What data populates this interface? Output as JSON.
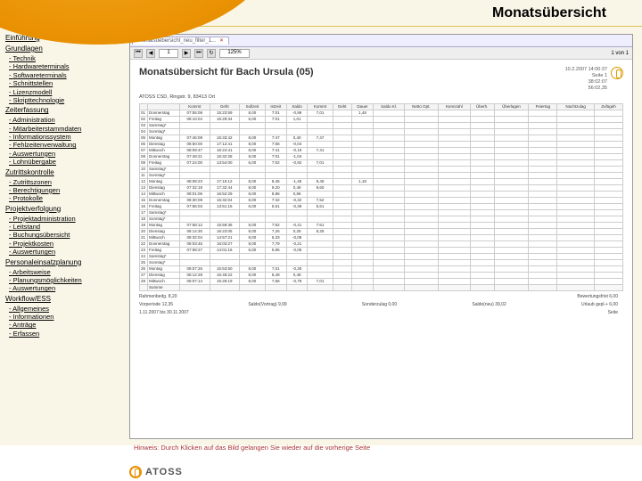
{
  "header": {
    "title": "Monatsübersicht"
  },
  "sidebar": [
    {
      "label": "Einführung",
      "items": []
    },
    {
      "label": "Grundlagen",
      "items": [
        "Technik",
        "Hardwareterminals",
        "Softwareterminals",
        "Schnittstellen",
        "Lizenzmodell",
        "Skripttechnologie"
      ]
    },
    {
      "label": "Zeiterfassung",
      "items": [
        "Administration",
        "Mitarbeiterstammdaten",
        "Informationssystem",
        "Fehlzeitenverwaltung",
        "Auswertungen",
        "Lohnübergabe"
      ]
    },
    {
      "label": "Zutrittskontrolle",
      "items": [
        "Zutrittszonen",
        "Berechtigungen",
        "Protokolle"
      ]
    },
    {
      "label": "Projektverfolgung",
      "items": [
        "Projektadministration",
        "Leitstand",
        "Buchungsübersicht",
        "Projektkosten",
        "Auswertungen"
      ]
    },
    {
      "label": "Personaleinsatzplanung",
      "items": [
        "Arbeitsweise",
        "Planungsmöglichkeiten",
        "Auswertungen"
      ]
    },
    {
      "label": "Workflow/ESS",
      "items": [
        "Allgemeines",
        "Informationen",
        "Anträge",
        "Erfassen"
      ]
    }
  ],
  "tab": {
    "label": "Monatsuebersicht_neu_filter_1...",
    "close": "×"
  },
  "toolbar": {
    "page_value": "1",
    "page_of": "1 von 1",
    "zoom": "125%"
  },
  "doc": {
    "title": "Monatsübersicht für Bach Ursula (05)",
    "meta_right": [
      "10.2.2007 14:00:37",
      "Seite 1",
      "38:02:07",
      "56:02,35"
    ],
    "subline": "ATOSS CSD, Ringstr. 9, 83413 Ort",
    "columns": [
      "",
      "",
      "Kommt",
      "Geht",
      "Sollzeit",
      "Istzeit",
      "Saldo",
      "Kommt",
      "Geht",
      "Dauer",
      "Saldo Kl.",
      "Netto Opt.",
      "Kennzahl",
      "Überh.",
      "Überlagen",
      "Feiertag",
      "Nachtzulag",
      "Zufügeh"
    ],
    "rows": [
      [
        "01",
        "Donnerstag",
        "07:55:08",
        "15:23:59",
        "8,00",
        "7:01",
        "-0,99",
        "7,01",
        "",
        "1,48",
        "",
        "",
        "",
        "",
        "",
        "",
        "",
        ""
      ],
      [
        "02",
        "Freitag",
        "08:10:04",
        "15:29:34",
        "6,00",
        "7:01",
        "1,01",
        "",
        "",
        "",
        "",
        "",
        "",
        "",
        "",
        "",
        "",
        ""
      ],
      [
        "03",
        "Samstag*",
        "",
        "",
        "",
        "",
        "",
        "",
        "",
        "",
        "",
        "",
        "",
        "",
        "",
        "",
        "",
        ""
      ],
      [
        "04",
        "Sonntag*",
        "",
        "",
        "",
        "",
        "",
        "",
        "",
        "",
        "",
        "",
        "",
        "",
        "",
        "",
        "",
        ""
      ],
      [
        "05",
        "Montag",
        "07:46:08",
        "15:33:42",
        "8,00",
        "7:47",
        "0,40",
        "7,47",
        "",
        "",
        "",
        "",
        "",
        "",
        "",
        "",
        "",
        ""
      ],
      [
        "06",
        "Dienstag",
        "08:50:00",
        "17:12:41",
        "8,00",
        "7:56",
        "-0,04",
        "",
        "",
        "",
        "",
        "",
        "",
        "",
        "",
        "",
        "",
        ""
      ],
      [
        "07",
        "Mittwoch",
        "08:09:47",
        "16:24:41",
        "8,00",
        "7:41",
        "-0,19",
        "7,41",
        "",
        "",
        "",
        "",
        "",
        "",
        "",
        "",
        "",
        ""
      ],
      [
        "08",
        "Donnerstag",
        "07:48:21",
        "16:32:28",
        "8,00",
        "7:01",
        "-1,04",
        "",
        "",
        "",
        "",
        "",
        "",
        "",
        "",
        "",
        "",
        ""
      ],
      [
        "09",
        "Freitag",
        "07:24:00",
        "13:54:00",
        "6,00",
        "7:02",
        "-0,92",
        "7,01",
        "",
        "",
        "",
        "",
        "",
        "",
        "",
        "",
        "",
        ""
      ],
      [
        "10",
        "Samstag*",
        "",
        "",
        "",
        "",
        "",
        "",
        "",
        "",
        "",
        "",
        "",
        "",
        "",
        "",
        "",
        ""
      ],
      [
        "11",
        "Sonntag*",
        "",
        "",
        "",
        "",
        "",
        "",
        "",
        "",
        "",
        "",
        "",
        "",
        "",
        "",
        "",
        ""
      ],
      [
        "12",
        "Montag",
        "08:08:23",
        "17:15:12",
        "8,00",
        "8,45",
        "-1,45",
        "8,45",
        "",
        "1,18",
        "",
        "",
        "",
        "",
        "",
        "",
        "",
        ""
      ],
      [
        "13",
        "Dienstag",
        "07:32:19",
        "17:32:44",
        "8,00",
        "9,20",
        "0,46",
        "9,60",
        "",
        "",
        "",
        "",
        "",
        "",
        "",
        "",
        "",
        ""
      ],
      [
        "14",
        "Mittwoch",
        "08:01:06",
        "16:52:29",
        "8,00",
        "8,86",
        "0,86",
        "",
        "",
        "",
        "",
        "",
        "",
        "",
        "",
        "",
        "",
        ""
      ],
      [
        "15",
        "Donnerstag",
        "08:30:08",
        "16:32:04",
        "8,00",
        "7:32",
        "-0,32",
        "7,52",
        "",
        "",
        "",
        "",
        "",
        "",
        "",
        "",
        "",
        ""
      ],
      [
        "16",
        "Freitag",
        "07:55:03",
        "13:51:15",
        "6,00",
        "5,61",
        "-0,39",
        "5,61",
        "",
        "",
        "",
        "",
        "",
        "",
        "",
        "",
        "",
        ""
      ],
      [
        "17",
        "Samstag*",
        "",
        "",
        "",
        "",
        "",
        "",
        "",
        "",
        "",
        "",
        "",
        "",
        "",
        "",
        "",
        ""
      ],
      [
        "18",
        "Sonntag*",
        "",
        "",
        "",
        "",
        "",
        "",
        "",
        "",
        "",
        "",
        "",
        "",
        "",
        "",
        "",
        ""
      ],
      [
        "19",
        "Montag",
        "07:58:12",
        "15:59:36",
        "8,00",
        "7:62",
        "-0,41",
        "7:61",
        "",
        "",
        "",
        "",
        "",
        "",
        "",
        "",
        "",
        ""
      ],
      [
        "20",
        "Dienstag",
        "08:14:30",
        "16:23:05",
        "8,00",
        "7,25",
        "0,25",
        "8,25",
        "",
        "",
        "",
        "",
        "",
        "",
        "",
        "",
        "",
        ""
      ],
      [
        "21",
        "Mittwoch",
        "08:32:04",
        "14:57:21",
        "8,00",
        "6,33",
        "-0,08",
        "",
        "",
        "",
        "",
        "",
        "",
        "",
        "",
        "",
        "",
        ""
      ],
      [
        "22",
        "Donnerstag",
        "08:03:45",
        "16:03:27",
        "8,00",
        "7,79",
        "-0,21",
        "",
        "",
        "",
        "",
        "",
        "",
        "",
        "",
        "",
        "",
        ""
      ],
      [
        "23",
        "Freitag",
        "07:58:27",
        "14:01:16",
        "6,00",
        "5,95",
        "-0,05",
        "",
        "",
        "",
        "",
        "",
        "",
        "",
        "",
        "",
        "",
        ""
      ],
      [
        "24",
        "Samstag*",
        "",
        "",
        "",
        "",
        "",
        "",
        "",
        "",
        "",
        "",
        "",
        "",
        "",
        "",
        "",
        ""
      ],
      [
        "25",
        "Sonntag*",
        "",
        "",
        "",
        "",
        "",
        "",
        "",
        "",
        "",
        "",
        "",
        "",
        "",
        "",
        "",
        ""
      ],
      [
        "26",
        "Montag",
        "08:07:26",
        "15:53:50",
        "8,00",
        "7,01",
        "-0,30",
        "",
        "",
        "",
        "",
        "",
        "",
        "",
        "",
        "",
        "",
        ""
      ],
      [
        "27",
        "Dienstag",
        "08:12:28",
        "16:48:22",
        "8,00",
        "8,48",
        "0,48",
        "",
        "",
        "",
        "",
        "",
        "",
        "",
        "",
        "",
        "",
        ""
      ],
      [
        "28",
        "Mittwoch",
        "08:07:14",
        "15:28:19",
        "8,00",
        "7,56",
        "-0,79",
        "7,01",
        "",
        "",
        "",
        "",
        "",
        "",
        "",
        "",
        "",
        ""
      ]
    ],
    "summary": [
      [
        "",
        "Summe",
        "",
        "",
        "",
        "",
        "",
        "",
        "",
        "",
        "",
        "",
        "",
        "",
        "",
        "",
        "",
        ""
      ]
    ],
    "footer_left": [
      "Rahmenbedg.  8,20",
      "Bewertungsfrist  6,00"
    ],
    "footer_bottom": [
      "Vorperiode  12,35",
      "Saldo(Vortrag)  9,99",
      "Sonderzulag  0,00",
      "Saldo(neu)  39,02",
      "Urlaub gepl.+  6,00"
    ],
    "date_range": "1.11.2007 bis 30.11.2007",
    "page_label": "Seite"
  },
  "hint": "Hinweis: Durch Klicken auf das Bild gelangen Sie wieder auf die vorherige Seite",
  "brand": "ATOSS"
}
